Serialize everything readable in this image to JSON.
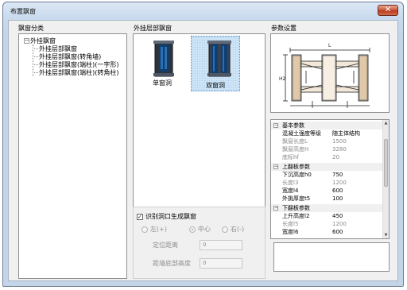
{
  "window": {
    "title": "布置飘窗",
    "close_glyph": "✕"
  },
  "category_panel": {
    "label": "飘窗分类",
    "root": {
      "expander": "−",
      "label": "外挂飘窗"
    },
    "items": [
      "外挂层部飘窗",
      "外挂层部飘窗(转角墙)",
      "外挂层部飘窗(端柱)(一字形)",
      "外挂层部飘窗(端柱)(转角柱)"
    ]
  },
  "type_panel": {
    "label": "外挂层部飘窗",
    "tiles": [
      {
        "caption": "单窗洞",
        "selected": false
      },
      {
        "caption": "双窗洞",
        "selected": true
      }
    ]
  },
  "params_panel": {
    "label": "参数设置"
  },
  "preview_labels": {
    "left_dim": "H2",
    "top_dim": "L"
  },
  "properties": {
    "groups": [
      {
        "expander": "−",
        "title": "基本参数",
        "rows": [
          {
            "key": "混凝土强度等级",
            "value": "随主体结构",
            "readonly": false
          },
          {
            "key": "飘窗长度L",
            "value": "1500",
            "readonly": true
          },
          {
            "key": "飘窗高度H",
            "value": "3280",
            "readonly": true
          },
          {
            "key": "底标hf",
            "value": "20",
            "readonly": true
          }
        ]
      },
      {
        "expander": "−",
        "title": "上翻板参数",
        "rows": [
          {
            "key": "下沉高度h0",
            "value": "750",
            "readonly": false
          },
          {
            "key": "长度l3",
            "value": "1200",
            "readonly": true
          },
          {
            "key": "宽度l4",
            "value": "600",
            "readonly": false
          },
          {
            "key": "外挑厚度t5",
            "value": "100",
            "readonly": false
          }
        ]
      },
      {
        "expander": "−",
        "title": "下翻板参数",
        "rows": [
          {
            "key": "上升高度l2",
            "value": "450",
            "readonly": false
          },
          {
            "key": "长度l5",
            "value": "1200",
            "readonly": true
          },
          {
            "key": "宽度l6",
            "value": "600",
            "readonly": false
          }
        ]
      }
    ]
  },
  "options": {
    "checkbox_label": "识别洞口生成飘窗",
    "checked": true,
    "check_glyph": "✓",
    "radios": [
      {
        "label": "左(+)",
        "selected": false
      },
      {
        "label": "中心",
        "selected": true
      },
      {
        "label": "右(-)",
        "selected": false
      }
    ],
    "position_distance": {
      "label": "定位距离",
      "value": "0"
    },
    "bottom_distance": {
      "label": "距墙底部高度",
      "value": "0"
    }
  }
}
